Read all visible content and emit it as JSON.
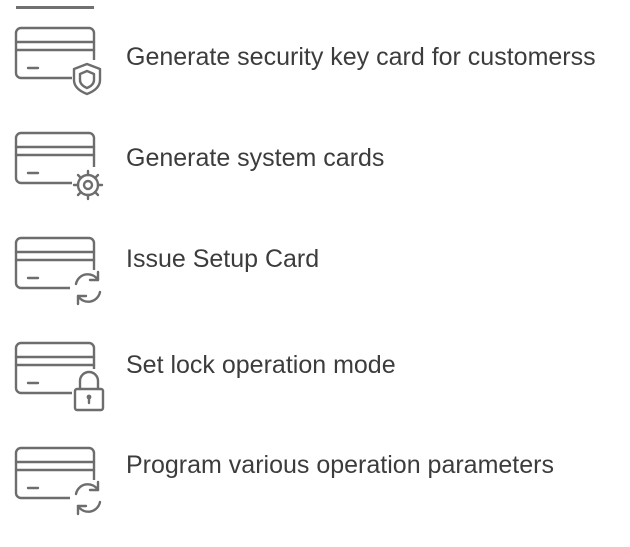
{
  "menu": {
    "items": [
      {
        "label": "Generate security key card for customerss",
        "icon": "card-shield-icon"
      },
      {
        "label": "Generate system cards",
        "icon": "card-gear-icon"
      },
      {
        "label": "Issue Setup Card",
        "icon": "card-refresh-icon"
      },
      {
        "label": "Set lock operation mode",
        "icon": "card-lock-icon"
      },
      {
        "label": "Program various operation parameters",
        "icon": "card-refresh-icon"
      }
    ]
  },
  "colors": {
    "icon_stroke": "#6d6d6d",
    "text": "#3c3c3c",
    "background": "#ffffff"
  }
}
